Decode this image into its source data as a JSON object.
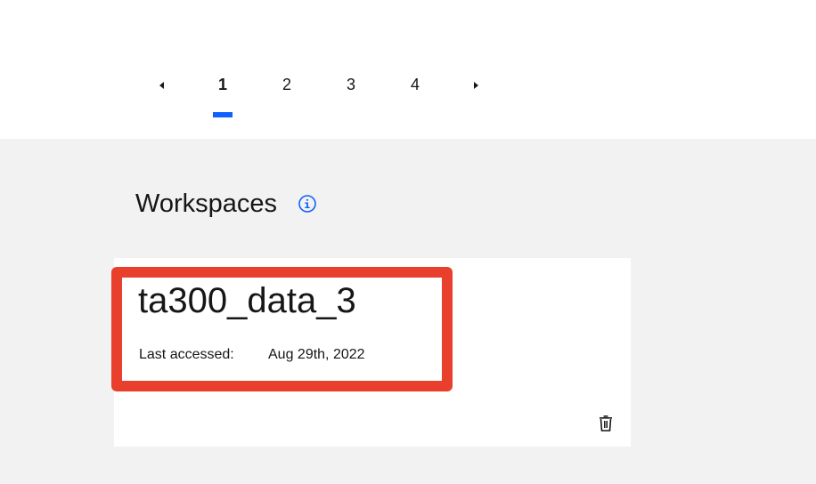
{
  "pagination": {
    "prev_icon": "caret-left-icon",
    "next_icon": "caret-right-icon",
    "pages": [
      "1",
      "2",
      "3",
      "4"
    ],
    "current_page": "1",
    "accent_color": "#0f62fe"
  },
  "workspaces": {
    "title": "Workspaces",
    "info_icon": "info-icon",
    "cards": [
      {
        "name": "ta300_data_3",
        "last_accessed_label": "Last accessed:",
        "last_accessed_value": "Aug 29th, 2022",
        "delete_icon": "trash-icon"
      }
    ]
  },
  "colors": {
    "background": "#f2f2f2",
    "card": "#ffffff",
    "highlight": "#e8402d",
    "text": "#161616",
    "info_icon": "#0f62fe"
  }
}
